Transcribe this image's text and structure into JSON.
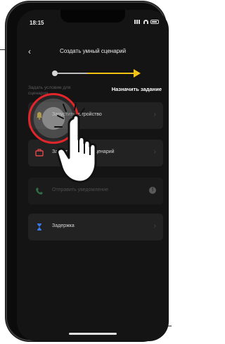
{
  "status_bar": {
    "time": "18:15"
  },
  "header": {
    "back_label": "‹",
    "title": "Создать умный сценарий"
  },
  "steps": {
    "condition_label": "Задать условие для сценария",
    "task_label": "Назначить задание"
  },
  "tasks": [
    {
      "label": "Запустить устройство",
      "icon": "bell-icon",
      "enabled": true
    },
    {
      "label": "Запустить умный сценарий",
      "icon": "scene-icon",
      "enabled": true
    },
    {
      "label": "Отправить уведомление",
      "icon": "phone-notify-icon",
      "enabled": false
    },
    {
      "label": "Задержка",
      "icon": "hourglass-icon",
      "enabled": true
    }
  ],
  "colors": {
    "accent": "#f4c315",
    "highlight": "#e2252b",
    "card": "#222222",
    "screen": "#141414"
  }
}
